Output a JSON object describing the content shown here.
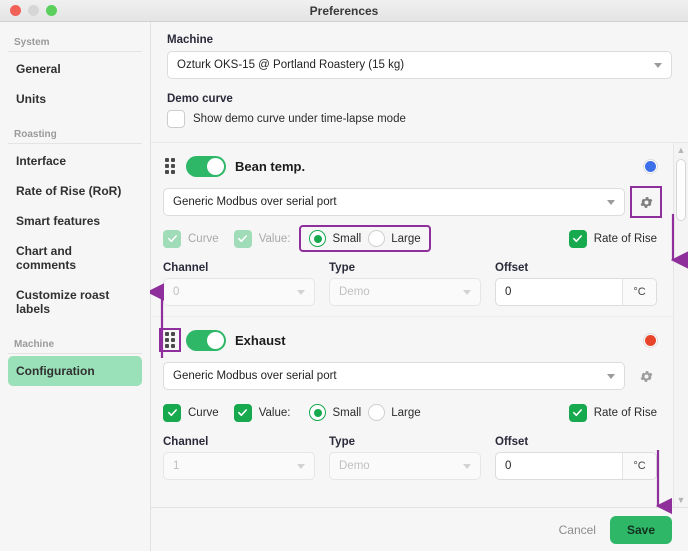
{
  "window": {
    "title": "Preferences"
  },
  "traffic_lights": [
    {
      "name": "close",
      "color": "#f16057"
    },
    {
      "name": "minimize",
      "color": "#d6d6d6"
    },
    {
      "name": "zoom",
      "color": "#5cd05c"
    }
  ],
  "sidebar": {
    "groups": [
      {
        "label": "System",
        "items": [
          {
            "label": "General",
            "active": false
          },
          {
            "label": "Units",
            "active": false
          }
        ]
      },
      {
        "label": "Roasting",
        "items": [
          {
            "label": "Interface",
            "active": false
          },
          {
            "label": "Rate of Rise (RoR)",
            "active": false
          },
          {
            "label": "Smart features",
            "active": false
          },
          {
            "label": "Chart and comments",
            "active": false
          },
          {
            "label": "Customize roast labels",
            "active": false
          }
        ]
      },
      {
        "label": "Machine",
        "items": [
          {
            "label": "Configuration",
            "active": true
          }
        ]
      }
    ]
  },
  "machine": {
    "label": "Machine",
    "selected": "Ozturk OKS-15 @ Portland Roastery (15 kg)"
  },
  "demo_curve": {
    "label": "Demo curve",
    "checkbox_label": "Show demo curve under time-lapse mode",
    "checked": false
  },
  "devices": [
    {
      "name": "Bean temp.",
      "enabled": true,
      "dot_color": "#3b70ea",
      "source": "Generic Modbus over serial port",
      "gear_highlighted": true,
      "handle_highlighted": false,
      "curve": {
        "label": "Curve",
        "checked": true,
        "disabled": true
      },
      "value": {
        "label": "Value:",
        "checked": true,
        "disabled": true
      },
      "size": {
        "options": [
          "Small",
          "Large"
        ],
        "selected": "Small",
        "highlighted": true
      },
      "rate_of_rise": {
        "label": "Rate of Rise",
        "checked": true,
        "disabled": false
      },
      "channel": {
        "label": "Channel",
        "value": "0",
        "disabled": true
      },
      "type": {
        "label": "Type",
        "value": "Demo",
        "disabled": true
      },
      "offset": {
        "label": "Offset",
        "value": "0",
        "unit": "°C"
      }
    },
    {
      "name": "Exhaust",
      "enabled": true,
      "dot_color": "#e8442a",
      "source": "Generic Modbus over serial port",
      "gear_highlighted": false,
      "handle_highlighted": true,
      "curve": {
        "label": "Curve",
        "checked": true,
        "disabled": false
      },
      "value": {
        "label": "Value:",
        "checked": true,
        "disabled": false
      },
      "size": {
        "options": [
          "Small",
          "Large"
        ],
        "selected": "Small",
        "highlighted": false
      },
      "rate_of_rise": {
        "label": "Rate of Rise",
        "checked": true,
        "disabled": false
      },
      "channel": {
        "label": "Channel",
        "value": "1",
        "disabled": true
      },
      "type": {
        "label": "Type",
        "value": "Demo",
        "disabled": true
      },
      "offset": {
        "label": "Offset",
        "value": "0",
        "unit": "°C"
      }
    }
  ],
  "footer": {
    "cancel_label": "Cancel",
    "save_label": "Save"
  },
  "annotations": {
    "color": "#8e2f9c"
  }
}
